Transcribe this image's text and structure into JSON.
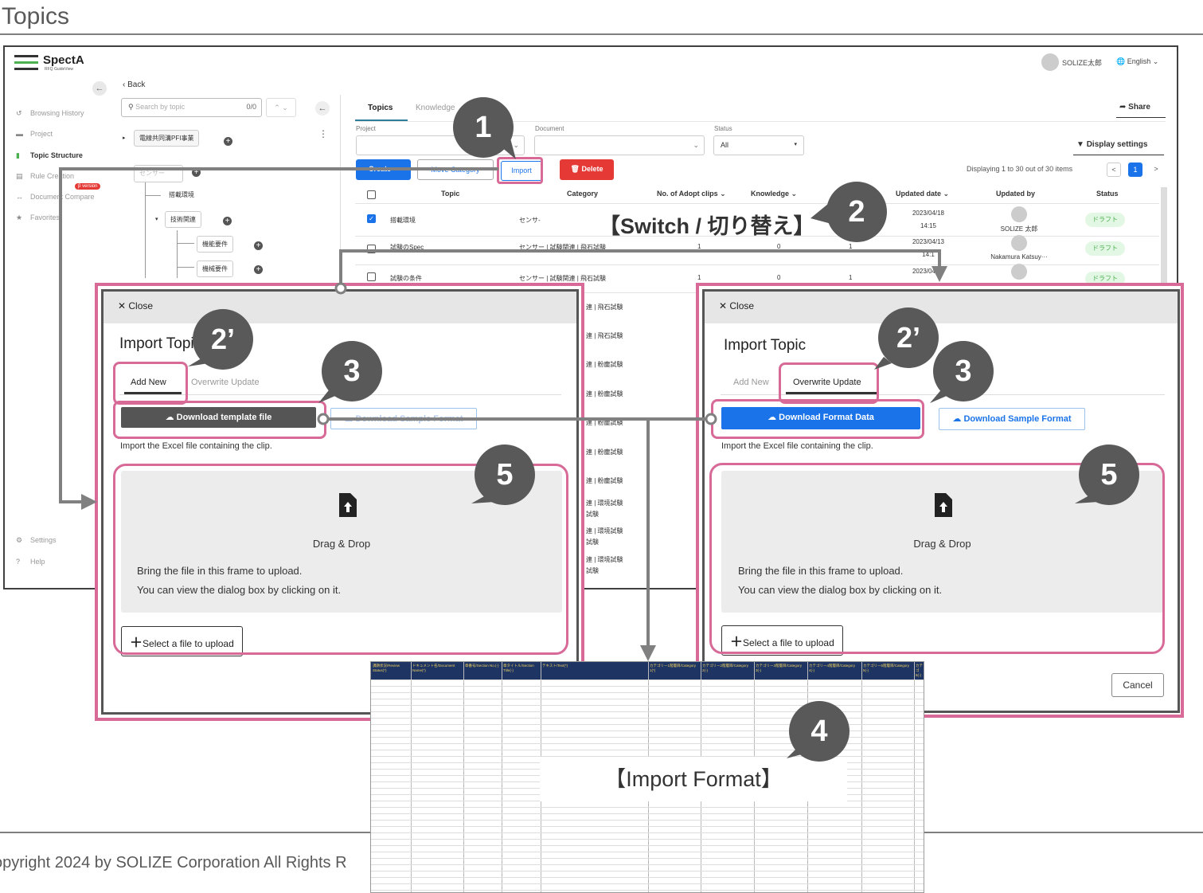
{
  "slide": {
    "title": "Topics",
    "footer": "opyright 2024 by SOLIZE Corporation All Rights R"
  },
  "app": {
    "logo": "SpectA",
    "logo_sub": "RFQ GuideView",
    "user": "SOLIZE太郎",
    "language": "English",
    "sidebar": [
      {
        "label": "Browsing History",
        "icon": "history-icon"
      },
      {
        "label": "Project",
        "icon": "briefcase-icon"
      },
      {
        "label": "Topic Structure",
        "icon": "clipboard-icon",
        "active": true
      },
      {
        "label": "Rule Creation",
        "icon": "document-icon",
        "badge": "β version"
      },
      {
        "label": "Document Compare",
        "icon": "compare-icon"
      },
      {
        "label": "Favorites",
        "icon": "star-icon"
      },
      {
        "label": "Settings",
        "icon": "gear-icon"
      },
      {
        "label": "Help",
        "icon": "help-icon"
      }
    ],
    "back_label": "Back",
    "search_placeholder": "Search by topic",
    "search_count": "0/0",
    "tree": {
      "root": "電線共同溝PFI事業",
      "n1": "センサー",
      "n2": "搭載環境",
      "n3": "技術関連",
      "n4": "機能要件",
      "n5": "機械要件"
    },
    "tabs": [
      "Topics",
      "Knowledge"
    ],
    "share": "Share",
    "filters": {
      "project_label": "Project",
      "document_label": "Document",
      "status_label": "Status",
      "status_value": "All"
    },
    "display_settings": "Display settings",
    "buttons": {
      "create": "Create",
      "move_category": "Move Category",
      "import": "Import",
      "delete": "Delete"
    },
    "pagination": {
      "info": "Displaying 1 to 30 out of 30 items",
      "prev": "<",
      "current": "1",
      "next": ">"
    },
    "table": {
      "headers": [
        "Topic",
        "Category",
        "No. of Adopt clips",
        "Knowledge",
        "Updated date",
        "Updated by",
        "Status"
      ],
      "rows": [
        {
          "topic": "搭載環境",
          "category": "センサ-",
          "clips": "",
          "knowledge": "",
          "x": "",
          "date": "2023/04/18",
          "time": "14:15",
          "by": "SOLIZE 太郎",
          "status": "ドラフト",
          "checked": true
        },
        {
          "topic": "試験のSpec",
          "category": "センサー | 試験関連 | 飛石試験",
          "clips": "1",
          "knowledge": "0",
          "x": "1",
          "date": "2023/04/13",
          "time": "14:1",
          "by": "Nakamura Katsuy···",
          "status": "ドラフト",
          "checked": false
        },
        {
          "topic": "試験の条件",
          "category": "センサー | 試験関連 | 飛石試験",
          "clips": "1",
          "knowledge": "0",
          "x": "1",
          "date": "2023/04/13",
          "time": "14:1",
          "by": "",
          "status": "ドラフト",
          "checked": false
        }
      ],
      "category_tail": [
        "連 | 飛石試験",
        "連 | 飛石試験",
        "連 | 粉塵試験",
        "連 | 粉塵試験",
        "連 | 粉塵試験",
        "連 | 粉塵試験",
        "連 | 粉塵試験",
        "連 | 環境試験",
        "試験",
        "連 | 環境試験",
        "試験",
        "連 | 環境試験",
        "試験"
      ]
    }
  },
  "modal_left": {
    "close": "Close",
    "title": "Import Topic",
    "tab_add": "Add New",
    "tab_overwrite": "Overwrite Update",
    "primary_button": "Download template file",
    "secondary_button": "Download Sample Format",
    "note": "Import the Excel file containing the clip.",
    "drop_title": "Drag & Drop",
    "drop_line1": "Bring the file in this frame to upload.",
    "drop_line2": "You can view the dialog box by clicking on it.",
    "select_button": "Select a file to upload"
  },
  "modal_right": {
    "close": "Close",
    "title": "Import Topic",
    "tab_add": "Add New",
    "tab_overwrite": "Overwrite Update",
    "primary_button": "Download Format Data",
    "secondary_button": "Download Sample Format",
    "note": "Import the Excel file containing the clip.",
    "drop_title": "Drag & Drop",
    "drop_line1": "Bring the file in this frame to upload.",
    "drop_line2": "You can view the dialog box by clicking on it.",
    "select_button": "Select a file to upload",
    "cancel": "Cancel"
  },
  "annotations": {
    "c1": "1",
    "c2": "2",
    "c2p": "2’",
    "c3": "3",
    "c4": "4",
    "c5": "5",
    "switch": "【Switch / 切り替え】",
    "import_format": "【Import Format】"
  },
  "sheet": {
    "headers": [
      "課題状況/Review Status(*)",
      "ドキュメント名/Document Name(*)",
      "章番号/Section No.(-)",
      "章タイトル/Section Title(-)",
      "テキスト/Text(*)",
      "カテゴリー1階層目/Category 1(*)",
      "カテゴリー2階層目/Category 2(-)",
      "カテゴリー3階層目/Category 3(-)",
      "カテゴリー4階層目/Category 4(-)",
      "カテゴリー5階層目/Category 5(-)",
      "カテゴ 6(-)"
    ]
  },
  "colors": {
    "highlight": "#d86a98",
    "primary": "#1a73e8",
    "callout": "#595959",
    "delete": "#e53935"
  }
}
